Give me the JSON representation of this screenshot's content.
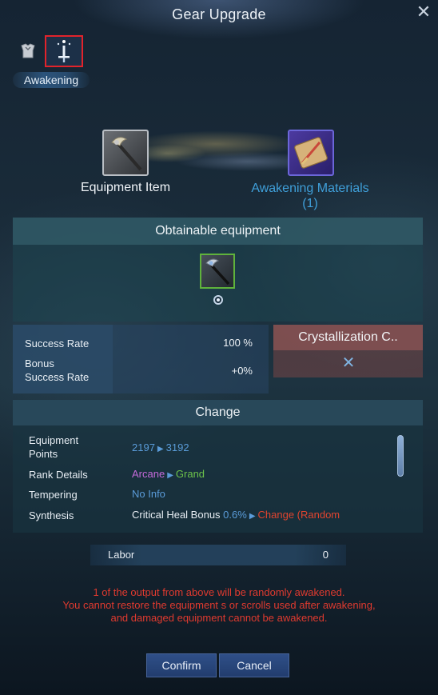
{
  "window": {
    "title": "Gear Upgrade"
  },
  "tabs": [
    {
      "name": "armor-tab",
      "icon": "armor-icon"
    },
    {
      "name": "awakening-tab",
      "icon": "awakening-sword-icon",
      "label": "Awakening",
      "selected": true
    }
  ],
  "slots": {
    "equipment_label": "Equipment Item",
    "materials_label": "Awakening Materials",
    "materials_count": "(1)"
  },
  "obtainable": {
    "title": "Obtainable equipment"
  },
  "rates": {
    "success_rate_label": "Success Rate",
    "success_rate_value": "100 %",
    "bonus_label_line1": "Bonus",
    "bonus_label_line2": "Success Rate",
    "bonus_value": "+0%"
  },
  "crystallization": {
    "title": "Crystallization C.."
  },
  "change": {
    "title": "Change",
    "rows": [
      {
        "label_line1": "Equipment",
        "label_line2": "Points",
        "from": "2197",
        "to": "3192"
      },
      {
        "label": "Rank Details",
        "from": "Arcane",
        "to": "Grand"
      },
      {
        "label": "Tempering",
        "value": "No Info"
      },
      {
        "label": "Synthesis",
        "stat": "Critical Heal Bonus",
        "from": "0.6%",
        "to": "Change (Random"
      }
    ]
  },
  "labor": {
    "label": "Labor",
    "value": "0"
  },
  "warning": {
    "line1": "1 of the output from above will be randomly awakened.",
    "line2": "You cannot restore the equipment s or scrolls used after awakening,",
    "line3": "and damaged equipment cannot be awakened."
  },
  "buttons": {
    "confirm": "Confirm",
    "cancel": "Cancel"
  },
  "colors": {
    "accent_blue": "#3f9fd9",
    "warning_red": "#e03a2f",
    "rank_arcane": "#c46ad9",
    "rank_grand": "#6cc24a",
    "tab_highlight": "#e2232b"
  }
}
